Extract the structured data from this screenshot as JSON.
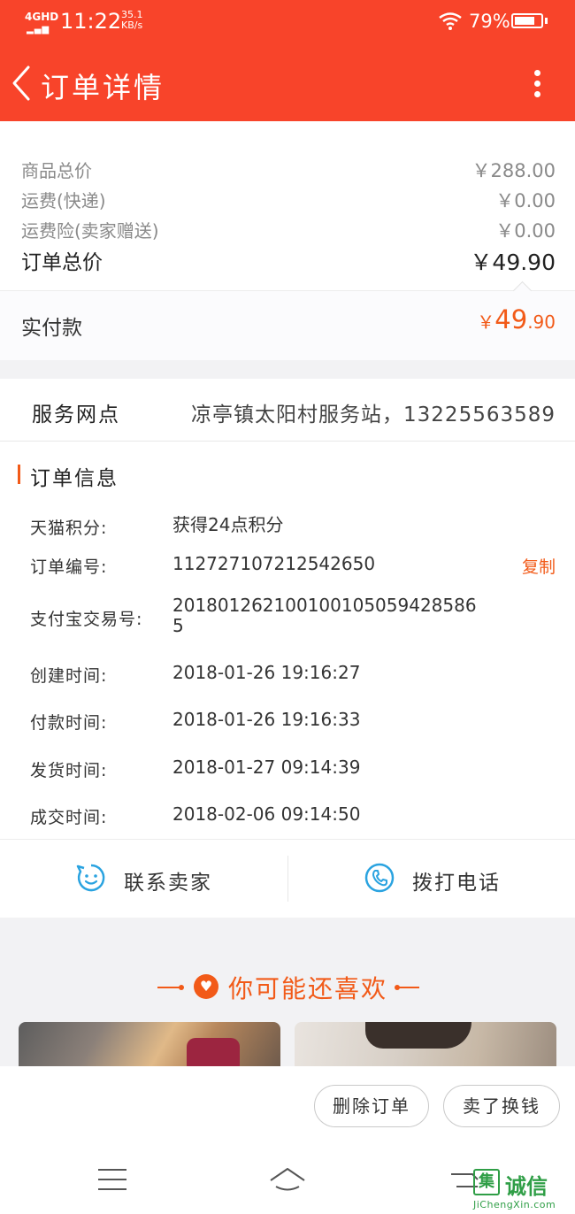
{
  "status_bar": {
    "network": "4GHD",
    "time": "11:22",
    "speed_value": "35.1",
    "speed_unit": "KB/s",
    "battery": "79%",
    "battery_level": 0.79
  },
  "header": {
    "title": "订单详情"
  },
  "prices": {
    "items": [
      {
        "label": "商品总价",
        "value": "￥288.00"
      },
      {
        "label": "运费(快递)",
        "value": "￥0.00"
      },
      {
        "label": "运费险(卖家赠送)",
        "value": "￥0.00"
      }
    ],
    "total_label": "订单总价",
    "total_value": "￥49.90",
    "paid_label": "实付款",
    "paid_currency": "￥",
    "paid_integer": "49",
    "paid_decimal": ".90"
  },
  "service": {
    "label": "服务网点",
    "value": "凉亭镇太阳村服务站，13225563589"
  },
  "order_info": {
    "title": "订单信息",
    "copy_label": "复制",
    "rows": [
      {
        "key": "天猫积分:",
        "value": "获得24点积分"
      },
      {
        "key": "订单编号:",
        "value": "112727107212542650"
      },
      {
        "key": "支付宝交易号:",
        "value": "2018012621001001050594285865"
      },
      {
        "key": "创建时间:",
        "value": "2018-01-26 19:16:27"
      },
      {
        "key": "付款时间:",
        "value": "2018-01-26 19:16:33"
      },
      {
        "key": "发货时间:",
        "value": "2018-01-27 09:14:39"
      },
      {
        "key": "成交时间:",
        "value": "2018-02-06 09:14:50"
      }
    ]
  },
  "contact": {
    "seller_label": "联系卖家",
    "phone_label": "拨打电话"
  },
  "recommend": {
    "title": "你可能还喜欢"
  },
  "actions": {
    "delete_label": "删除订单",
    "sell_label": "卖了换钱"
  },
  "watermark": {
    "logo_char": "集",
    "name": "诚信",
    "url": "JiChengXin.com"
  },
  "colors": {
    "brand": "#f8442a",
    "accent": "#f25a18",
    "contact_icon": "#2aa3e0"
  }
}
